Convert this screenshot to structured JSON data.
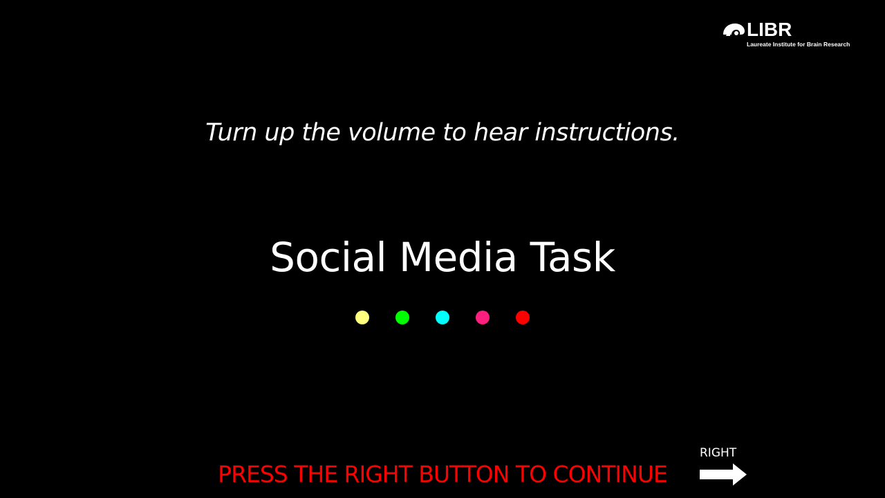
{
  "logo": {
    "icon": "brain-icon",
    "wordmark": "LIBR",
    "subtitle": "Laureate Institute for Brain Research"
  },
  "instruction": {
    "volume_text": "Turn up the volume to hear instructions."
  },
  "task": {
    "title": "Social Media Task"
  },
  "dots": [
    {
      "color": "#ffff7f"
    },
    {
      "color": "#00ff00"
    },
    {
      "color": "#00ffff"
    },
    {
      "color": "#ff1f7f"
    },
    {
      "color": "#ff0000"
    }
  ],
  "footer": {
    "continue_text": "PRESS THE RIGHT BUTTON TO CONTINUE",
    "continue_color": "#ff0000",
    "right_label": "RIGHT",
    "right_icon": "right-arrow-icon"
  }
}
